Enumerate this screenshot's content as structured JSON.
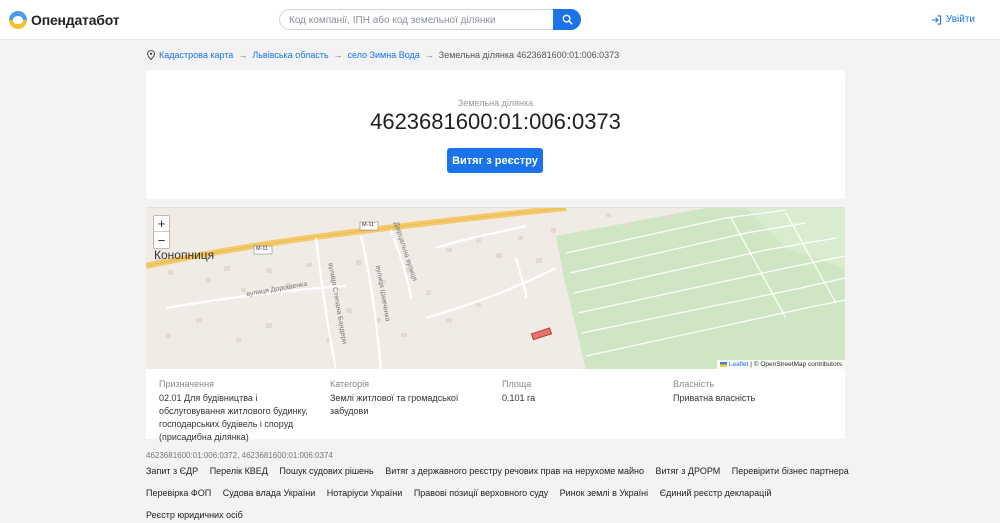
{
  "header": {
    "logo_text": "Опендатабот",
    "search_placeholder": "Код компанії, ІПН або код земельної ділянки",
    "login_label": "Увійти"
  },
  "breadcrumb": {
    "items": [
      "Кадастрова карта",
      "Львівська область",
      "село Зимна Вода",
      "Земельна ділянка 4623681600:01:006:0373"
    ],
    "separator": "→"
  },
  "parcel": {
    "subtitle": "Земельна ділянка",
    "cadastral_number": "4623681600:01:006:0373",
    "extract_button": "Витяг з реєстру"
  },
  "map": {
    "town_label": "Конопниця",
    "road_labels": [
      "М-11",
      "М-11"
    ],
    "street_labels": [
      "вулиця Дорошенка",
      "вулиця Степана Бандери",
      "вулиця Шевченка",
      "Двірцальна вулиця"
    ],
    "zoom_in": "+",
    "zoom_out": "−",
    "attribution_leaflet": "Leaflet",
    "attribution_rest": "| © OpenStreetMap contributors",
    "parcel_color": "#e8736b"
  },
  "info": {
    "purpose_label": "Призначення",
    "purpose_value": "02.01 Для будівництва і обслуговування житлового будинку, господарських будівель і споруд (присадибна ділянка)",
    "category_label": "Категорія",
    "category_value": "Землі житлової та громадської забудови",
    "area_label": "Площа",
    "area_value": "0.101 га",
    "ownership_label": "Власність",
    "ownership_value": "Приватна власність"
  },
  "neighbors": "4623681600:01:006:0372, 4623681600:01:006:0374",
  "footer_links": {
    "row1": [
      "Запит з ЄДР",
      "Перелік КВЕД",
      "Пошук судових рішень",
      "Витяг з державного реєстру речових прав на нерухоме майно",
      "Витяг з ДРОРМ",
      "Перевірити бізнес партнера"
    ],
    "row2": [
      "Перевірка ФОП",
      "Судова влада України",
      "Нотаріуси України",
      "Правові позиції верховного суду",
      "Ринок землі в Україні",
      "Єдиний реєстр декларацій"
    ],
    "row3": [
      "Реєстр юридичних осіб"
    ]
  },
  "colors": {
    "accent": "#1a73e8",
    "background": "#f3f3f4"
  }
}
